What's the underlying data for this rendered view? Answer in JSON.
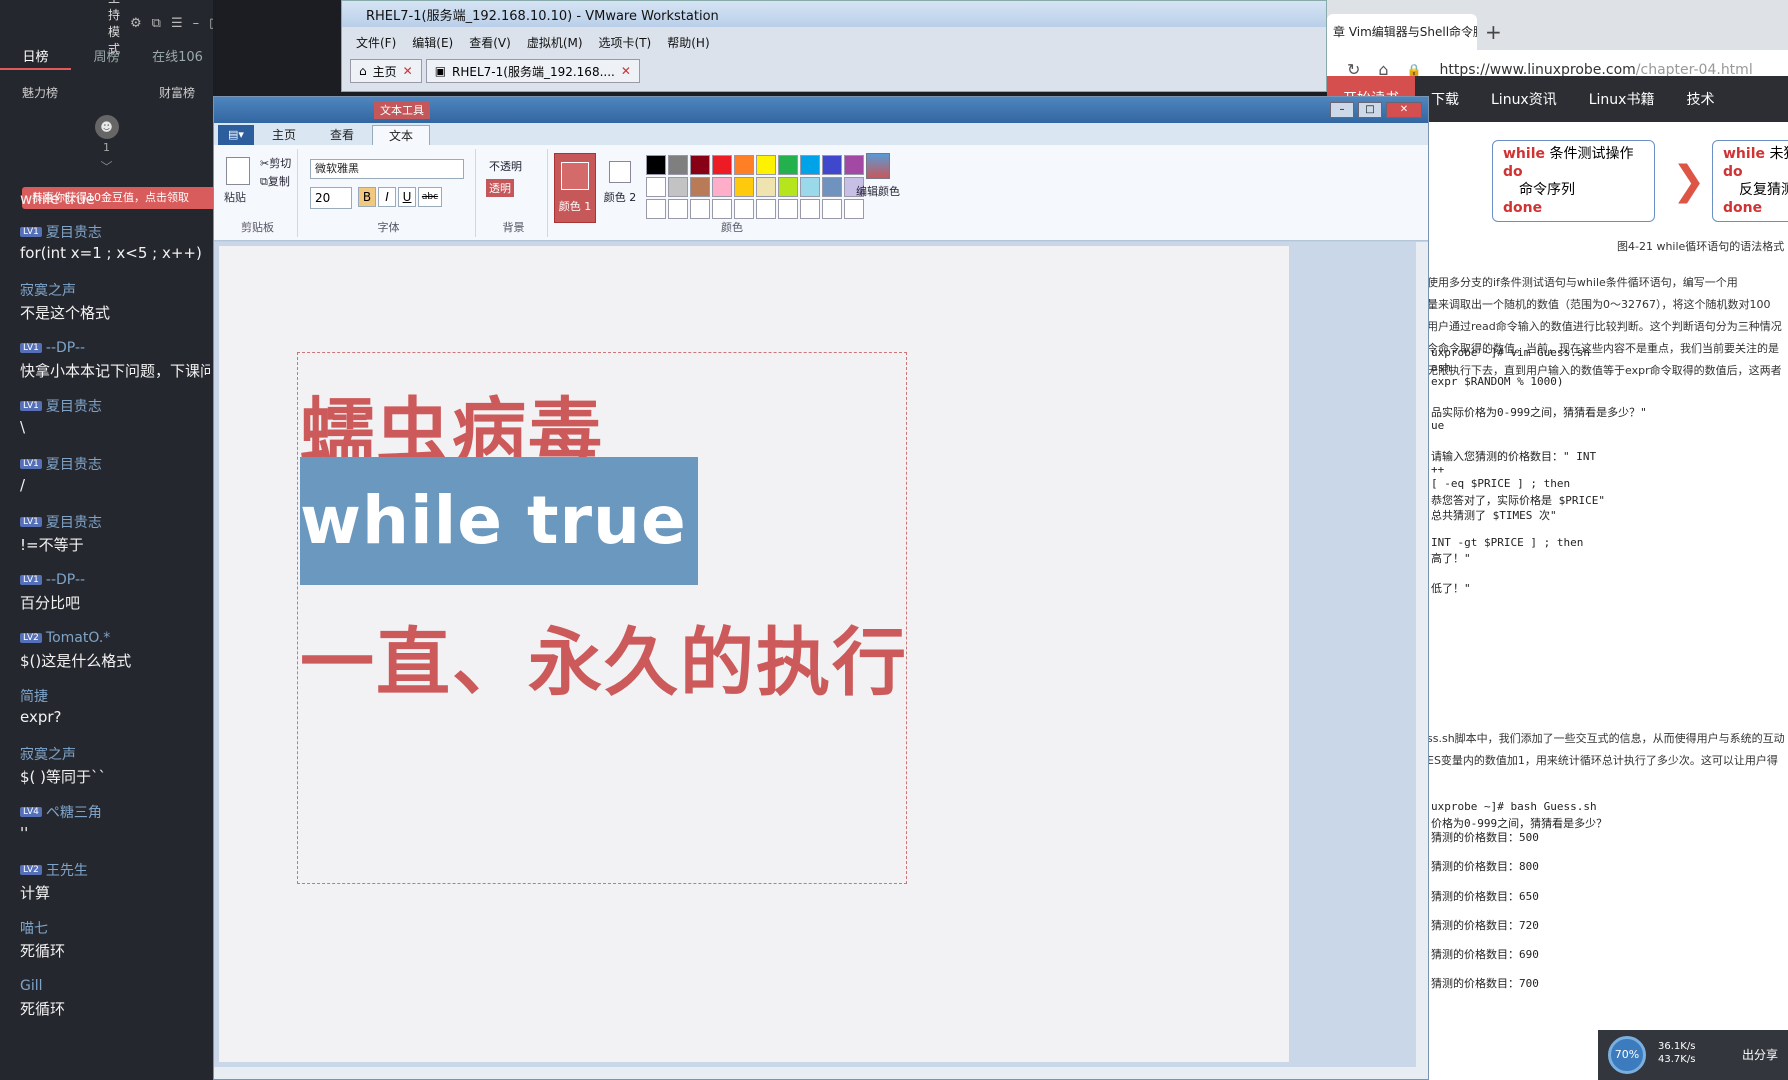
{
  "chat": {
    "host_mode": "主持模式",
    "tabs": [
      "日榜",
      "周榜",
      "在线106"
    ],
    "charm": "魅力榜",
    "wealth": "财富榜",
    "rank": "1",
    "banner": "恭喜你获得10金豆值，点击领取",
    "messages": [
      {
        "user": "",
        "text": "while true",
        "lv": ""
      },
      {
        "user": "夏目贵志",
        "text": "for(int x=1 ; x<5 ; x++)",
        "lv": "LV1"
      },
      {
        "user": "寂寞之声",
        "text": "不是这个格式",
        "lv": ""
      },
      {
        "user": "--DP--",
        "text": "快拿小本本记下问题，下课问",
        "lv": "LV1"
      },
      {
        "user": "夏目贵志",
        "text": "\\",
        "lv": "LV1"
      },
      {
        "user": "夏目贵志",
        "text": "/",
        "lv": "LV1"
      },
      {
        "user": "夏目贵志",
        "text": "!=不等于",
        "lv": "LV1"
      },
      {
        "user": "--DP--",
        "text": "百分比吧",
        "lv": "LV1"
      },
      {
        "user": "TomatO.*",
        "text": "$()这是什么格式",
        "lv": "LV2"
      },
      {
        "user": "简捷",
        "text": "expr?",
        "lv": ""
      },
      {
        "user": "寂寞之声",
        "text": "$( )等同于``",
        "lv": ""
      },
      {
        "user": "ペ糖三角",
        "text": "''",
        "lv": "LV4"
      },
      {
        "user": "王先生",
        "text": "计算",
        "lv": "LV2"
      },
      {
        "user": "喵七",
        "text": "死循环",
        "lv": ""
      },
      {
        "user": "Gill",
        "text": "死循环",
        "lv": ""
      }
    ]
  },
  "vmware": {
    "title": "RHEL7-1(服务端_192.168.10.10) - VMware Workstation",
    "menu": [
      "文件(F)",
      "编辑(E)",
      "查看(V)",
      "虚拟机(M)",
      "选项卡(T)",
      "帮助(H)"
    ],
    "tab_home": "主页",
    "tab_vm": "RHEL7-1(服务端_192.168...."
  },
  "paint": {
    "context_tab": "文本工具",
    "tabs": [
      "主页",
      "查看",
      "文本"
    ],
    "clipboard": {
      "paste": "粘贴",
      "cut": "剪切",
      "copy": "复制",
      "label": "剪贴板"
    },
    "font": {
      "name": "微软雅黑",
      "size": "20",
      "bold": "B",
      "italic": "I",
      "underline": "U",
      "strike": "abc",
      "label": "字体"
    },
    "background": {
      "opaque": "不透明",
      "transparent": "透明",
      "label": "背景"
    },
    "colors": {
      "color1": "颜色 1",
      "color2": "颜色 2",
      "edit": "编辑颜色",
      "label": "颜色"
    },
    "lines": [
      "蠕虫病毒",
      "while true",
      "一直、永久的执行"
    ]
  },
  "browser": {
    "tab_title": "章 Vim编辑器与Shell命令脚",
    "url_domain": "https://www.linuxprobe.com",
    "url_path": "/chapter-04.html",
    "nav": [
      "开始读书",
      "下载",
      "Linux资讯",
      "Linux书籍",
      "技术"
    ],
    "fig1": {
      "l1_kw": "while",
      "l1": "条件测试操作",
      "l2": "do",
      "l3": "命令序列",
      "l4": "done"
    },
    "fig2": {
      "l1_kw": "while",
      "l1": "未猜",
      "l2": "do",
      "l3": "反复猜测",
      "l4": "done"
    },
    "caption": "图4-21  while循环语句的语法格式",
    "paragraphs": [
      "使用多分支的if条件测试语句与while条件循环语句，编写一个用",
      "量来调取出一个随机的数值（范围为0～32767），将这个随机数对100",
      "用户通过read命令输入的数值进行比较判断。这个判断语句分为三种情况",
      "令命令取得的数值。当前，现在这些内容不是重点，我们当前要关注的是",
      "无限执行下去，直到用户输入的数值等于expr命令取得的数值后，这两者"
    ],
    "code1": [
      "uxprobe ~]# vim Guess.sh",
      "ash",
      "expr $RANDOM % 1000)",
      "",
      "品实际价格为0-999之间，猜猜看是多少？\"",
      "ue",
      "",
      "请输入您猜测的价格数目：\" INT",
      "++",
      "[ -eq $PRICE ] ; then",
      "恭您答对了，实际价格是 $PRICE\"",
      "总共猜测了 $TIMES 次\"",
      "",
      "INT -gt $PRICE ] ; then",
      "高了！\"",
      "",
      "低了！\""
    ],
    "paragraphs2": [
      "ss.sh脚本中，我们添加了一些交互式的信息，从而使得用户与系统的互动",
      "ES变量内的数值加1，用来统计循环总计执行了多少次。这可以让用户得"
    ],
    "code2": [
      "uxprobe ~]# bash Guess.sh",
      "价格为0-999之间，猜猜看是多少？",
      "猜测的价格数目：500",
      "",
      "猜测的价格数目：800",
      "",
      "猜测的价格数目：650",
      "",
      "猜测的价格数目：720",
      "",
      "猜测的价格数目：690",
      "",
      "猜测的价格数目：700"
    ]
  },
  "overlay": {
    "percent": "70%",
    "up": "36.1K/s",
    "down": "43.7K/s",
    "share": "出分享",
    "png": "png"
  },
  "palette_colors": [
    "#000000",
    "#7f7f7f",
    "#880015",
    "#ed1c24",
    "#ff7f27",
    "#fff200",
    "#22b14c",
    "#00a2e8",
    "#3f48cc",
    "#a349a4",
    "#ffffff",
    "#c3c3c3",
    "#b97a57",
    "#ffaec9",
    "#ffc90e",
    "#efe4b0",
    "#b5e61d",
    "#99d9ea",
    "#7092be",
    "#c8bfe7",
    "#ffffff",
    "#ffffff",
    "#ffffff",
    "#ffffff",
    "#ffffff",
    "#ffffff",
    "#ffffff",
    "#ffffff",
    "#ffffff",
    "#ffffff"
  ]
}
